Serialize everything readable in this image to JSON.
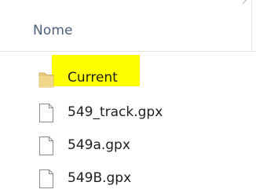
{
  "header": {
    "column_name": "Nome"
  },
  "files": [
    {
      "name": "Current",
      "type": "folder",
      "icon": "folder-icon",
      "highlighted": true
    },
    {
      "name": "549_track.gpx",
      "type": "file",
      "icon": "file-icon"
    },
    {
      "name": "549a.gpx",
      "type": "file",
      "icon": "file-icon"
    },
    {
      "name": "549B.gpx",
      "type": "file",
      "icon": "file-icon"
    }
  ],
  "colors": {
    "highlight": "#ffff00",
    "header_text": "#4c607a",
    "folder": "#e6c878"
  }
}
